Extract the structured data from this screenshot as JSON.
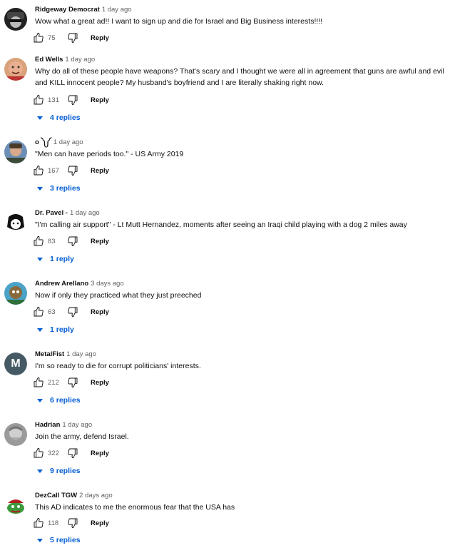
{
  "reply_button_label": "Reply",
  "comments": [
    {
      "author": "Ridgeway Democrat",
      "time": "1 day ago",
      "text": "Wow what a great ad!! I want to sign up and die for Israel and Big Business interests!!!!",
      "likes": "75",
      "replies": ""
    },
    {
      "author": "Ed Wells",
      "time": "1 day ago",
      "text": "Why do all of these people have weapons?  That's scary and I thought we were all in agreement that guns are awful and evil and KILL innocent people?  My husband's boyfriend and I are literally shaking right now.",
      "likes": "131",
      "replies": "4 replies"
    },
    {
      "author": "o ༽༼",
      "time": "1 day ago",
      "text": "\"Men can have periods too.\" - US Army 2019",
      "likes": "167",
      "replies": "3 replies"
    },
    {
      "author": "Dr. Pavel -",
      "time": "1 day ago",
      "text": "\"I'm calling air support\" - Lt Mutt Hernandez, moments after seeing an Iraqi child playing with a dog 2 miles away",
      "likes": "83",
      "replies": "1 reply"
    },
    {
      "author": "Andrew Arellano",
      "time": "3 days ago",
      "text": "Now if only they practiced what they just preeched",
      "likes": "63",
      "replies": "1 reply"
    },
    {
      "author": "MetalFist",
      "time": "1 day ago",
      "text": "I'm so ready to die for corrupt politicians' interests.",
      "likes": "212",
      "replies": "6 replies",
      "avatar_letter": "M"
    },
    {
      "author": "Hadrian",
      "time": "1 day ago",
      "text": "Join the army, defend Israel.",
      "likes": "322",
      "replies": "9 replies"
    },
    {
      "author": "DezCall TGW",
      "time": "2 days ago",
      "text": "This AD indicates to me the enormous fear that the USA has",
      "likes": "118",
      "replies": "5 replies"
    }
  ],
  "colors": {
    "link_blue": "#065fd4",
    "meta_gray": "#606060",
    "text": "#0f0f0f"
  },
  "icons": {
    "like": "thumb-up-outline",
    "dislike": "thumb-down-outline",
    "expand": "caret-down"
  }
}
